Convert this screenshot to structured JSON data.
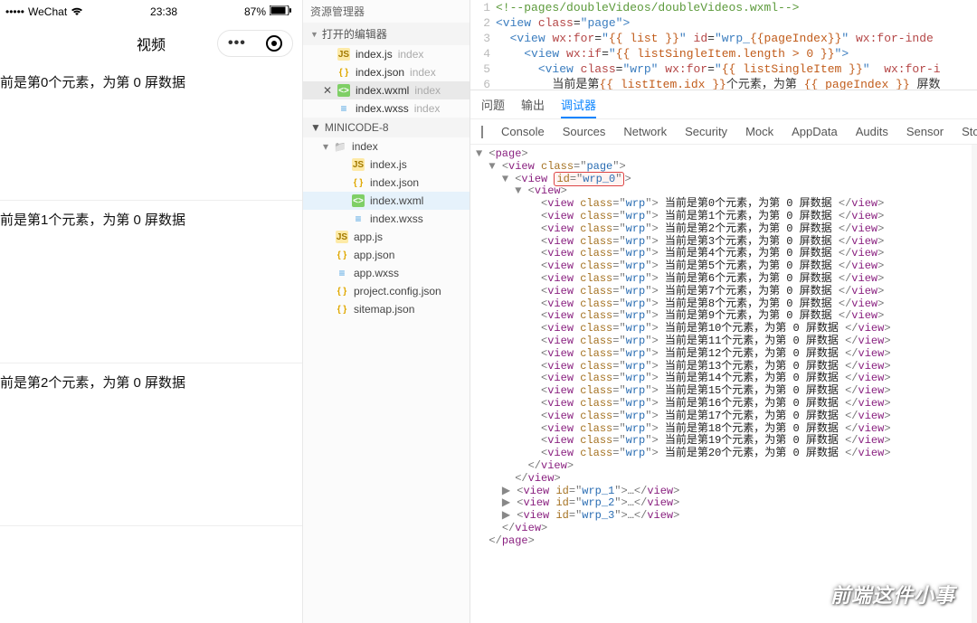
{
  "simulator": {
    "carrier": "WeChat",
    "signal_icon": "signal-dots",
    "wifi_icon": "wifi",
    "time": "23:38",
    "battery_pct": "87%",
    "title": "视频",
    "items": [
      "前是第0个元素，为第 0 屏数据",
      "前是第1个元素，为第 0 屏数据",
      "前是第2个元素，为第 0 屏数据"
    ]
  },
  "explorer": {
    "title": "资源管理器",
    "open_editors_label": "打开的编辑器",
    "open_editors": [
      {
        "icon": "js",
        "name": "index.js",
        "dir": "index",
        "active": false,
        "close": false
      },
      {
        "icon": "json",
        "name": "index.json",
        "dir": "index",
        "active": false,
        "close": false
      },
      {
        "icon": "wxml",
        "name": "index.wxml",
        "dir": "index",
        "active": true,
        "close": true
      },
      {
        "icon": "wxss",
        "name": "index.wxss",
        "dir": "index",
        "active": false,
        "close": false
      }
    ],
    "project_label": "MINICODE-8",
    "tree": [
      {
        "indent": 1,
        "icon": "folder",
        "name": "index",
        "caret": "▾"
      },
      {
        "indent": 2,
        "icon": "js",
        "name": "index.js"
      },
      {
        "indent": 2,
        "icon": "json",
        "name": "index.json"
      },
      {
        "indent": 2,
        "icon": "wxml",
        "name": "index.wxml",
        "selected": true
      },
      {
        "indent": 2,
        "icon": "wxss",
        "name": "index.wxss"
      },
      {
        "indent": 1,
        "icon": "js",
        "name": "app.js"
      },
      {
        "indent": 1,
        "icon": "json",
        "name": "app.json"
      },
      {
        "indent": 1,
        "icon": "wxss",
        "name": "app.wxss"
      },
      {
        "indent": 1,
        "icon": "json",
        "name": "project.config.json"
      },
      {
        "indent": 1,
        "icon": "json",
        "name": "sitemap.json"
      }
    ]
  },
  "editor": {
    "path_comment": "<!--pages/doubleVideos/doubleVideos.wxml-->",
    "lines": [
      {
        "n": 1,
        "html": "<span class='c-comment'>&lt;!--pages/doubleVideos/doubleVideos.wxml--&gt;</span>"
      },
      {
        "n": 2,
        "html": "<span class='c-tag'>&lt;view</span> <span class='c-attr'>class</span>=<span class='c-str'>\"page\"</span><span class='c-tag'>&gt;</span>"
      },
      {
        "n": 3,
        "html": "  <span class='c-tag'>&lt;view</span> <span class='c-attr'>wx:for</span>=<span class='c-str'>\"</span><span class='c-expr'>{{ list }}</span><span class='c-str'>\"</span> <span class='c-attr'>id</span>=<span class='c-str'>\"wrp_</span><span class='c-expr'>{{pageIndex}}</span><span class='c-str'>\"</span> <span class='c-attr'>wx:for-inde</span>"
      },
      {
        "n": 4,
        "html": "    <span class='c-tag'>&lt;view</span> <span class='c-attr'>wx:if</span>=<span class='c-str'>\"</span><span class='c-expr'>{{ listSingleItem.length &gt; 0 }}</span><span class='c-str'>\"</span><span class='c-tag'>&gt;</span>"
      },
      {
        "n": 5,
        "html": "      <span class='c-tag'>&lt;view</span> <span class='c-attr'>class</span>=<span class='c-str'>\"wrp\"</span> <span class='c-attr'>wx:for</span>=<span class='c-str'>\"</span><span class='c-expr'>{{ listSingleItem }}</span><span class='c-str'>\"</span>  <span class='c-attr'>wx:for-i</span>"
      },
      {
        "n": 6,
        "html": "        <span class='c-text'>当前是第</span><span class='c-expr'>{{ listItem.idx }}</span><span class='c-text'>个元素，为第 </span><span class='c-expr'>{{ pageIndex }}</span><span class='c-text'> 屏数</span>"
      }
    ]
  },
  "debugger": {
    "tabs1": [
      "问题",
      "输出",
      "调试器"
    ],
    "tabs1_active": 2,
    "tabs2": [
      "Console",
      "Sources",
      "Network",
      "Security",
      "Mock",
      "AppData",
      "Audits",
      "Sensor",
      "Stora"
    ],
    "tabs2_active": 0,
    "dom_root": "page",
    "highlight_attr": "id",
    "highlight_val": "wrp_0",
    "wrp_rows": [
      "当前是第0个元素，为第 0 屏数据",
      "当前是第1个元素，为第 0 屏数据",
      "当前是第2个元素，为第 0 屏数据",
      "当前是第3个元素，为第 0 屏数据",
      "当前是第4个元素，为第 0 屏数据",
      "当前是第5个元素，为第 0 屏数据",
      "当前是第6个元素，为第 0 屏数据",
      "当前是第7个元素，为第 0 屏数据",
      "当前是第8个元素，为第 0 屏数据",
      "当前是第9个元素，为第 0 屏数据",
      "当前是第10个元素，为第 0 屏数据",
      "当前是第11个元素，为第 0 屏数据",
      "当前是第12个元素，为第 0 屏数据",
      "当前是第13个元素，为第 0 屏数据",
      "当前是第14个元素，为第 0 屏数据",
      "当前是第15个元素，为第 0 屏数据",
      "当前是第16个元素，为第 0 屏数据",
      "当前是第17个元素，为第 0 屏数据",
      "当前是第18个元素，为第 0 屏数据",
      "当前是第19个元素，为第 0 屏数据",
      "当前是第20个元素，为第 0 屏数据"
    ],
    "collapsed_groups": [
      "wrp_1",
      "wrp_2",
      "wrp_3"
    ]
  },
  "watermark": "前端这件小事"
}
